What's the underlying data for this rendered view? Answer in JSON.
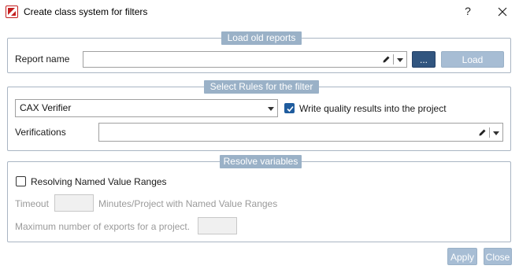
{
  "window": {
    "title": "Create class system for filters",
    "help_label": "?"
  },
  "load_old_reports": {
    "legend": "Load old reports",
    "report_name_label": "Report name",
    "report_name_value": "",
    "browse_label": "...",
    "load_label": "Load"
  },
  "select_rules": {
    "legend": "Select Rules for the filter",
    "rule_value": "CAX Verifier",
    "write_quality_label": "Write quality results into the project",
    "write_quality_checked": true,
    "verifications_label": "Verifications",
    "verifications_value": ""
  },
  "resolve_variables": {
    "legend": "Resolve variables",
    "resolving_label": "Resolving Named Value Ranges",
    "resolving_checked": false,
    "timeout_label": "Timeout",
    "timeout_value": "",
    "timeout_unit_label": "Minutes/Project with Named Value Ranges",
    "max_exports_label": "Maximum number of exports for a project.",
    "max_exports_value": ""
  },
  "footer": {
    "apply_label": "Apply",
    "close_label": "Close"
  },
  "colors": {
    "legend_bg": "#9ab1c7",
    "primary_button": "#31557f",
    "disabled_button": "#a7bdd4",
    "checkbox_checked": "#1f5c9e",
    "group_border": "#a9b5c3"
  }
}
